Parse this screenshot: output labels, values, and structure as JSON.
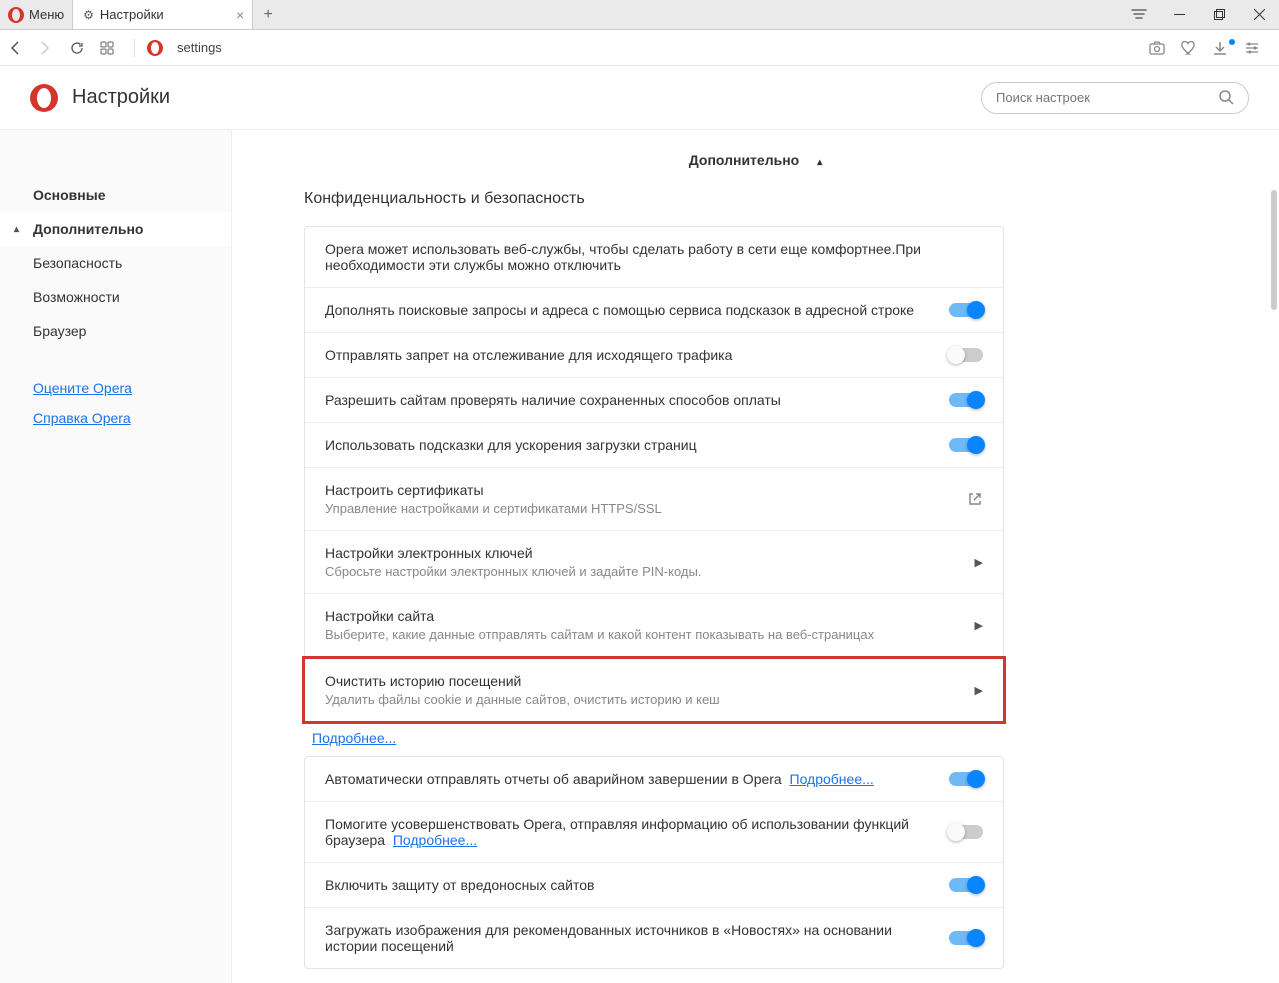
{
  "titlebar": {
    "menu": "Меню",
    "tab_title": "Настройки"
  },
  "addressbar": {
    "url": "settings"
  },
  "header": {
    "title": "Настройки",
    "search_placeholder": "Поиск настроек"
  },
  "sidebar": {
    "items": [
      {
        "label": "Основные",
        "bold": true,
        "active": false
      },
      {
        "label": "Дополнительно",
        "bold": true,
        "active": true,
        "caret": true
      },
      {
        "label": "Безопасность",
        "sub": true
      },
      {
        "label": "Возможности",
        "sub": true
      },
      {
        "label": "Браузер",
        "sub": true
      }
    ],
    "links": [
      {
        "label": "Оцените Opera"
      },
      {
        "label": "Справка Opera"
      }
    ]
  },
  "content": {
    "advanced_label": "Дополнительно",
    "privacy_title": "Конфиденциальность и безопасность",
    "rows": {
      "intro": "Opera может использовать веб-службы, чтобы сделать работу в сети еще комфортнее.При необходимости эти службы можно отключить",
      "suggest": "Дополнять поисковые запросы и адреса с помощью сервиса подсказок в адресной строке",
      "dnt": "Отправлять запрет на отслеживание для исходящего трафика",
      "payment": "Разрешить сайтам проверять наличие сохраненных способов оплаты",
      "preload": "Использовать подсказки для ускорения загрузки страниц",
      "certs_title": "Настроить сертификаты",
      "certs_desc": "Управление настройками и сертификатами HTTPS/SSL",
      "keys_title": "Настройки электронных ключей",
      "keys_desc": "Сбросьте настройки электронных ключей и задайте PIN-коды.",
      "site_title": "Настройки сайта",
      "site_desc": "Выберите, какие данные отправлять сайтам и какой контент показывать на веб-страницах",
      "clear_title": "Очистить историю посещений",
      "clear_desc": "Удалить файлы cookie и данные сайтов, очистить историю и кеш",
      "more": "Подробнее...",
      "crash": "Автоматически отправлять отчеты об аварийном завершении в Opera",
      "crash_more": "Подробнее...",
      "usage": "Помогите усовершенствовать Opera, отправляя информацию об использовании функций браузера",
      "usage_more": "Подробнее...",
      "malware": "Включить защиту от вредоносных сайтов",
      "news": "Загружать изображения для рекомендованных источников в «Новостях» на основании истории посещений"
    }
  }
}
